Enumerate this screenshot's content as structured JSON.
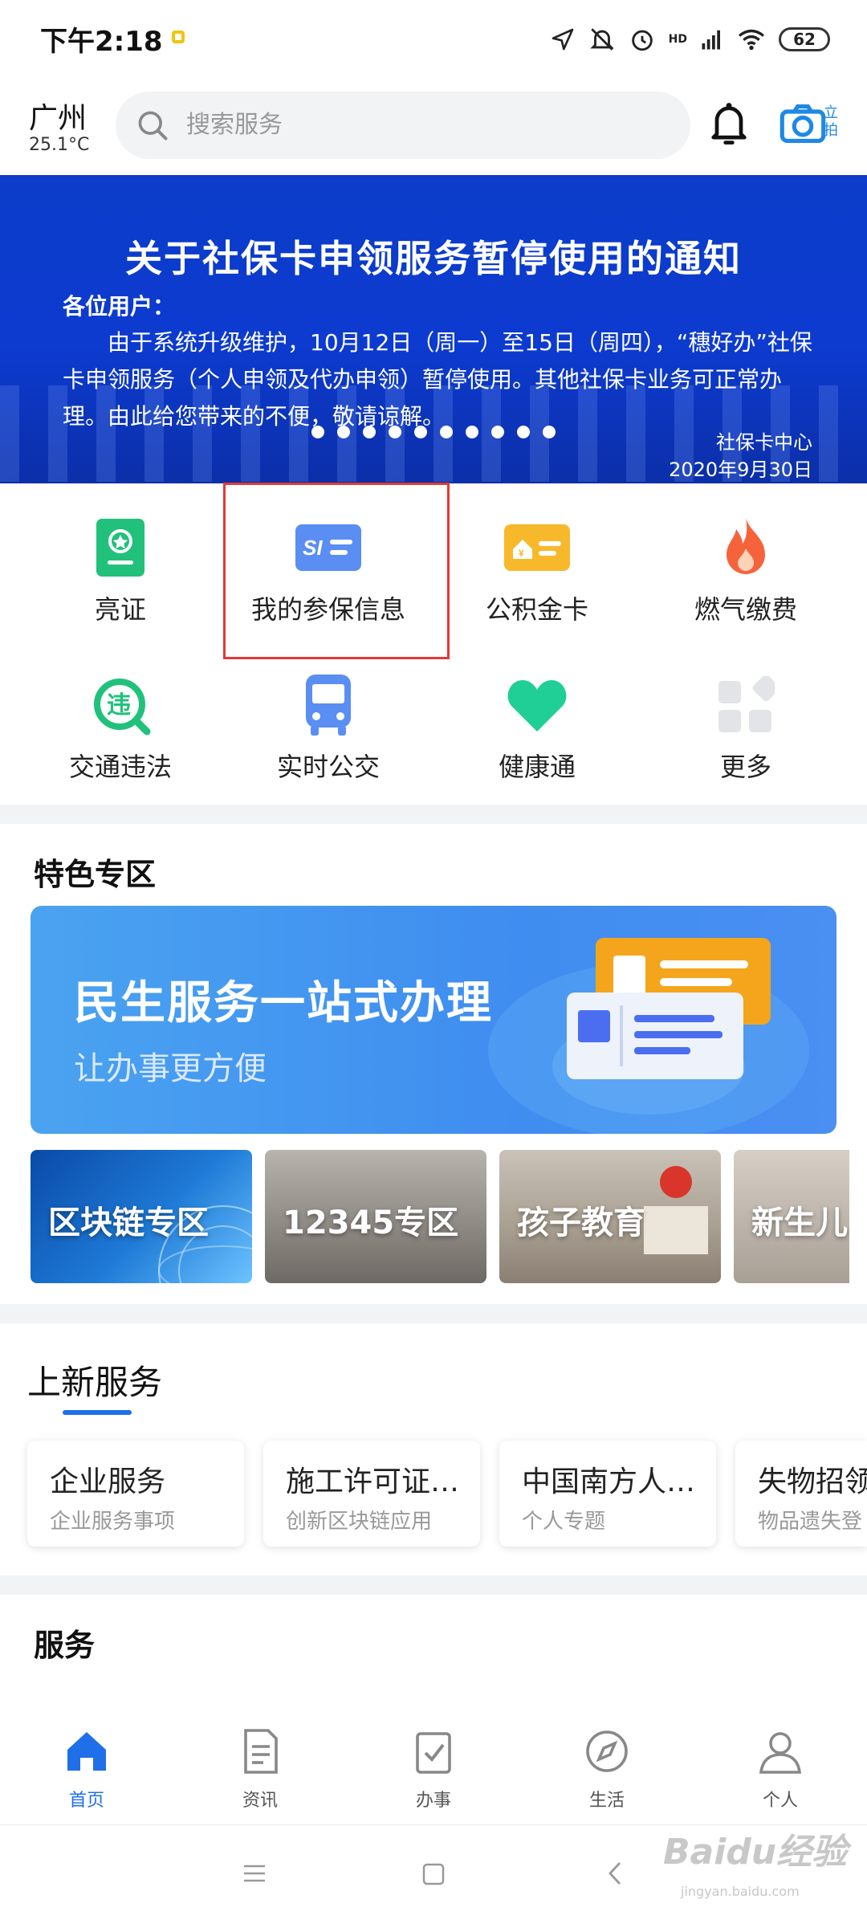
{
  "status_bar": {
    "time": "下午2:18",
    "network": "HD",
    "battery": "62"
  },
  "header": {
    "city": "广州",
    "temperature": "25.1°C",
    "search_placeholder": "搜索服务",
    "scan_label": "立拍"
  },
  "banner": {
    "title": "关于社保卡申领服务暂停使用的通知",
    "greeting": "各位用户：",
    "body": "由于系统升级维护，10月12日（周一）至15日（周四），“穗好办”社保卡申领服务（个人申领及代办申领）暂停使用。其他社保卡业务可正常办理。由此给您带来的不便，敬请谅解。",
    "signature": "社保卡中心",
    "date": "2020年9月30日",
    "page_count": 10
  },
  "quick_grid": [
    {
      "label": "亮证",
      "icon": "certificate-icon"
    },
    {
      "label": "我的参保信息",
      "icon": "social-insurance-card-icon"
    },
    {
      "label": "公积金卡",
      "icon": "housing-fund-card-icon"
    },
    {
      "label": "燃气缴费",
      "icon": "gas-flame-icon"
    },
    {
      "label": "交通违法",
      "icon": "traffic-violation-icon"
    },
    {
      "label": "实时公交",
      "icon": "bus-icon"
    },
    {
      "label": "健康通",
      "icon": "heart-icon"
    },
    {
      "label": "更多",
      "icon": "more-grid-icon"
    }
  ],
  "featured": {
    "title": "特色专区",
    "banner_title": "民生服务一站式办理",
    "banner_subtitle": "让办事更方便",
    "tiles": [
      {
        "label": "区块链专区"
      },
      {
        "label": "12345专区"
      },
      {
        "label": "孩子教育"
      },
      {
        "label": "新生儿"
      }
    ]
  },
  "new_services": {
    "title": "上新服务",
    "cards": [
      {
        "title": "企业服务",
        "subtitle": "企业服务事项"
      },
      {
        "title": "施工许可证…",
        "subtitle": "创新区块链应用"
      },
      {
        "title": "中国南方人…",
        "subtitle": "个人专题"
      },
      {
        "title": "失物招领",
        "subtitle": "物品遗失登"
      }
    ]
  },
  "services": {
    "title": "服务"
  },
  "bottom_nav": [
    {
      "label": "首页",
      "icon": "home-icon",
      "active": true
    },
    {
      "label": "资讯",
      "icon": "news-icon",
      "active": false
    },
    {
      "label": "办事",
      "icon": "task-check-icon",
      "active": false
    },
    {
      "label": "生活",
      "icon": "compass-icon",
      "active": false
    },
    {
      "label": "个人",
      "icon": "person-icon",
      "active": false
    }
  ],
  "watermark": {
    "text": "Baidu经验",
    "sub": "jingyan.baidu.com"
  },
  "colors": {
    "accent": "#1e6fe8",
    "banner": "#0c3cc9",
    "highlight": "#e53935"
  }
}
